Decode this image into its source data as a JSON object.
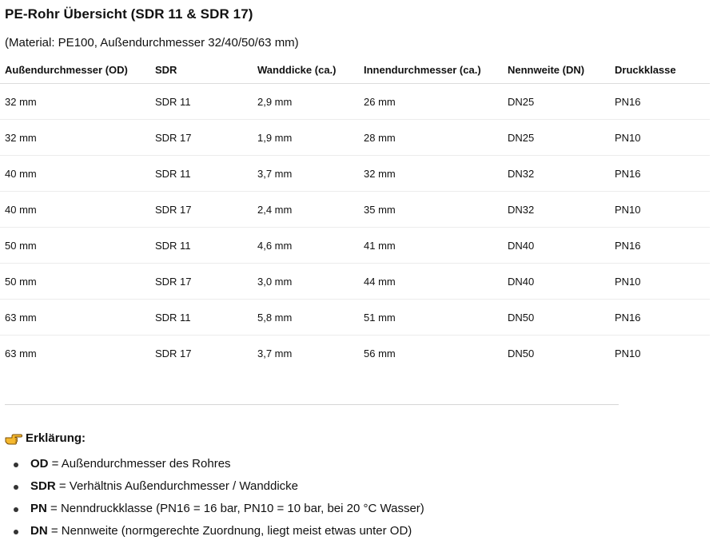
{
  "title": "PE-Rohr Übersicht (SDR 11 & SDR 17)",
  "subtitle": "(Material: PE100, Außendurchmesser 32/40/50/63 mm)",
  "table": {
    "headers": [
      "Außendurchmesser (OD)",
      "SDR",
      "Wanddicke (ca.)",
      "Innendurchmesser (ca.)",
      "Nennweite (DN)",
      "Druckklasse"
    ],
    "rows": [
      [
        "32 mm",
        "SDR 11",
        "2,9 mm",
        "26 mm",
        "DN25",
        "PN16"
      ],
      [
        "32 mm",
        "SDR 17",
        "1,9 mm",
        "28 mm",
        "DN25",
        "PN10"
      ],
      [
        "40 mm",
        "SDR 11",
        "3,7 mm",
        "32 mm",
        "DN32",
        "PN16"
      ],
      [
        "40 mm",
        "SDR 17",
        "2,4 mm",
        "35 mm",
        "DN32",
        "PN10"
      ],
      [
        "50 mm",
        "SDR 11",
        "4,6 mm",
        "41 mm",
        "DN40",
        "PN16"
      ],
      [
        "50 mm",
        "SDR 17",
        "3,0 mm",
        "44 mm",
        "DN40",
        "PN10"
      ],
      [
        "63 mm",
        "SDR 11",
        "5,8 mm",
        "51 mm",
        "DN50",
        "PN16"
      ],
      [
        "63 mm",
        "SDR 17",
        "3,7 mm",
        "56 mm",
        "DN50",
        "PN10"
      ]
    ]
  },
  "legend": {
    "icon": "pointing-hand-icon",
    "heading": "Erklärung:",
    "items": [
      {
        "term": "OD",
        "text": " = Außendurchmesser des Rohres"
      },
      {
        "term": "SDR",
        "text": " = Verhältnis Außendurchmesser / Wanddicke"
      },
      {
        "term": "PN",
        "text": " = Nenndruckklasse (PN16 = 16 bar, PN10 = 10 bar, bei 20 °C Wasser)"
      },
      {
        "term": "DN",
        "text": " = Nennweite (normgerechte Zuordnung, liegt meist etwas unter OD)"
      }
    ]
  },
  "colors": {
    "text": "#111111",
    "hand_fill": "#f5b82e",
    "hand_outline": "#7a4f0a"
  }
}
